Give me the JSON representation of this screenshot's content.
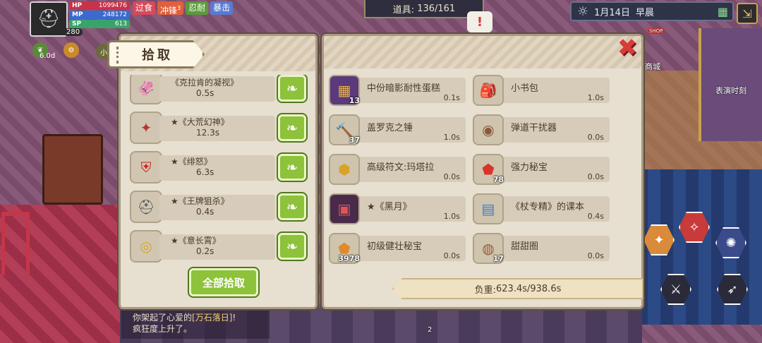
{
  "hud": {
    "hp_label": "HP",
    "hp_value": "1099476",
    "mp_label": "MP",
    "mp_value": "248172",
    "sp_label": "SP",
    "sp_value": "613",
    "level": "280",
    "buffs": [
      "过食",
      "冲锋",
      "忍耐",
      "暴击"
    ],
    "buff_stack": "3",
    "timer": "6.0d",
    "chip_label": "小"
  },
  "top_bar": {
    "items_label": "道具:",
    "items_value": "136/161",
    "date": "1月14日",
    "time_of_day": "早晨"
  },
  "map_labels": {
    "shop": "商城",
    "shop_sign": "SHOP",
    "stage": "表演时刻"
  },
  "pickup_panel": {
    "title": "拾取",
    "items": [
      {
        "name": "《克拉肯的凝视》",
        "time": "0.5s",
        "icon": "kraken-weapon-icon"
      },
      {
        "name": "★《大荒幻神》",
        "time": "12.3s",
        "icon": "fantasy-god-weapon-icon"
      },
      {
        "name": "★《绯怒》",
        "time": "6.3s",
        "icon": "crimson-rage-armor-icon"
      },
      {
        "name": "★《王牌狙杀》",
        "time": "0.4s",
        "icon": "ace-sniper-helmet-icon"
      },
      {
        "name": "★《意长霄》",
        "time": "0.2s",
        "icon": "sky-ring-icon"
      }
    ],
    "pick_all_label": "全部拾取"
  },
  "inventory_panel": {
    "items": [
      {
        "name": "中份暗影耐性蛋糕",
        "time": "0.1s",
        "count": "13",
        "icon": "shadow-cake-icon"
      },
      {
        "name": "小书包",
        "time": "1.0s",
        "count": "",
        "icon": "backpack-icon"
      },
      {
        "name": "盖罗克之锤",
        "time": "1.0s",
        "count": "37",
        "icon": "hammer-icon"
      },
      {
        "name": "弹道干扰器",
        "time": "0.0s",
        "count": "",
        "icon": "jammer-icon"
      },
      {
        "name": "高级符文:玛塔拉",
        "time": "0.0s",
        "count": "",
        "icon": "rune-icon"
      },
      {
        "name": "强力秘宝",
        "time": "0.0s",
        "count": "78",
        "icon": "red-gem-icon"
      },
      {
        "name": "★《黑月》",
        "time": "1.0s",
        "count": "",
        "icon": "black-moon-book-icon"
      },
      {
        "name": "《杖专精》的课本",
        "time": "0.4s",
        "count": "",
        "icon": "textbook-icon"
      },
      {
        "name": "初级健壮秘宝",
        "time": "0.0s",
        "count": "3978",
        "icon": "orange-gem-icon"
      },
      {
        "name": "甜甜圈",
        "time": "0.0s",
        "count": "17",
        "icon": "donut-icon"
      }
    ],
    "weight_label": "负重:",
    "weight_value": "623.4s/938.6s"
  },
  "chat": {
    "line1_prefix": "你架起了心爱的",
    "line1_item": "[万石落日]",
    "line1_suffix": "!",
    "line2": "疯狂度上升了。"
  },
  "bottom_counter": "2"
}
